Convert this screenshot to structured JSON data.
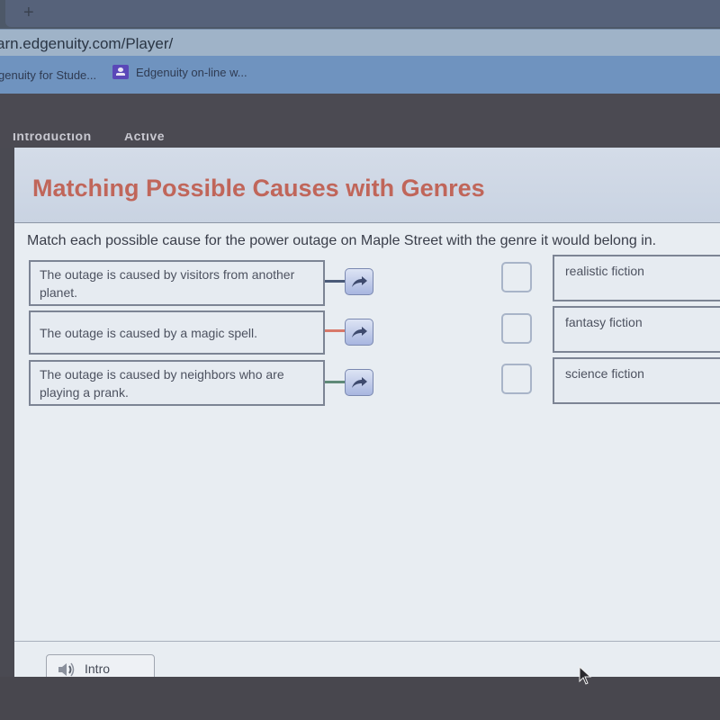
{
  "browser": {
    "new_tab_label": "+",
    "url": "arn.edgenuity.com/Player/",
    "bookmarks": [
      {
        "label": "genuity for Stude..."
      },
      {
        "label": "Edgenuity on-line w..."
      }
    ]
  },
  "app_header": {
    "tabs": [
      {
        "label": "Introduction"
      },
      {
        "label": "Active"
      }
    ]
  },
  "activity": {
    "title": "Matching Possible Causes with Genres",
    "instructions": "Match each possible cause for the power outage on Maple Street with the genre it would belong in.",
    "causes": [
      {
        "text": "The outage is caused by visitors from another planet.",
        "connector_color": "#4a5a78"
      },
      {
        "text": "The outage is caused by a magic spell.",
        "connector_color": "#d8796a"
      },
      {
        "text": "The outage is caused by neighbors who are playing a prank.",
        "connector_color": "#5f8a78"
      }
    ],
    "genres": [
      {
        "label": "realistic fiction"
      },
      {
        "label": "fantasy fiction"
      },
      {
        "label": "science fiction"
      }
    ]
  },
  "footer": {
    "intro_button_label": "Intro"
  },
  "colors": {
    "title": "#c0665a",
    "panel_bg": "#e8edf2",
    "arrow_button": "#a8b6e0"
  }
}
